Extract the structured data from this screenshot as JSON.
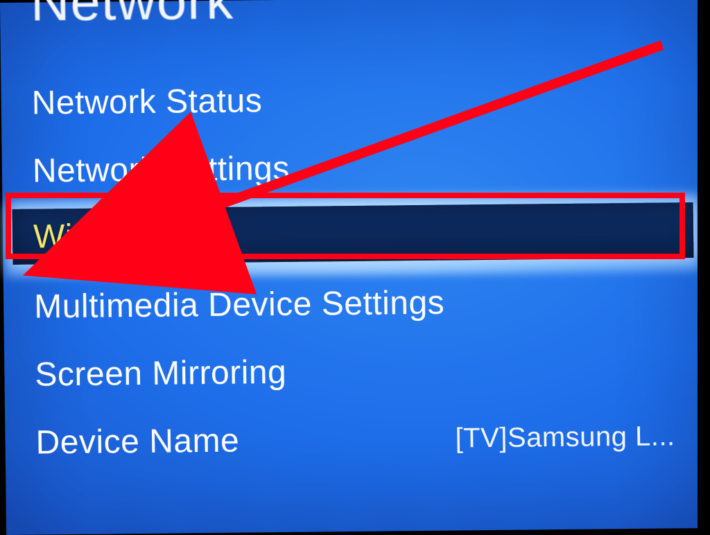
{
  "title": "Network",
  "menu": {
    "items": [
      {
        "label": "Network Status"
      },
      {
        "label": "Network Settings"
      },
      {
        "label": "Wi-Fi Direct",
        "selected": true
      },
      {
        "label": "Multimedia Device Settings"
      },
      {
        "label": "Screen Mirroring"
      },
      {
        "label": "Device Name",
        "value": "[TV]Samsung L..."
      }
    ]
  },
  "annotation": {
    "highlight_item_index": 2,
    "color": "#ff0016"
  }
}
